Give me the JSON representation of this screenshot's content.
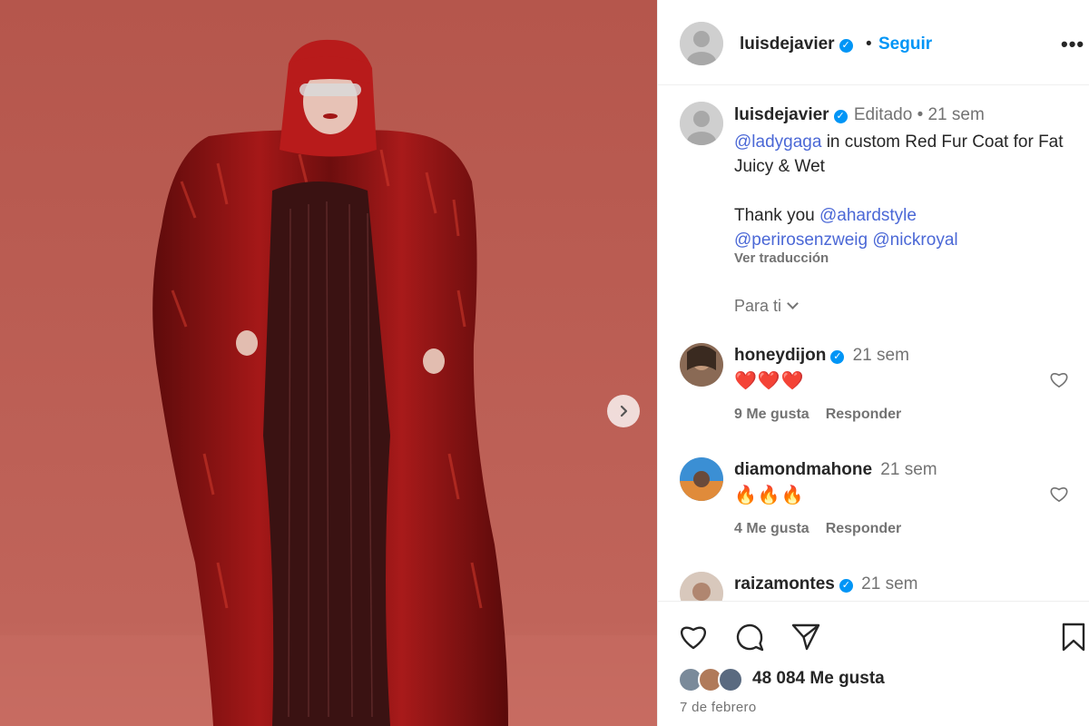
{
  "post": {
    "author": "luisdejavier",
    "verified": "✓",
    "dot": "•",
    "follow_label": "Seguir",
    "more_label": "•••"
  },
  "caption": {
    "author": "luisdejavier",
    "meta": "Editado • 21 sem",
    "mention_gaga": "@ladygaga",
    "line1_rest": " in custom Red Fur Coat for Fat Juicy & Wet",
    "thanks": "Thank you ",
    "mention_1": "@ahardstyle",
    "mention_2": "@perirosenzweig",
    "mention_3": "@nickroyal",
    "translate_label": "Ver traducción"
  },
  "filter": {
    "label": "Para ti"
  },
  "comments": [
    {
      "user": "honeydijon",
      "verified": true,
      "time": "21 sem",
      "text": "❤️❤️❤️",
      "likes": "9 Me gusta",
      "reply": "Responder"
    },
    {
      "user": "diamondmahone",
      "verified": false,
      "time": "21 sem",
      "text": "🔥🔥🔥",
      "likes": "4 Me gusta",
      "reply": "Responder"
    },
    {
      "user": "raizamontes",
      "verified": true,
      "time": "21 sem"
    }
  ],
  "footer": {
    "likes_label": "48 084 Me gusta",
    "date": "7 de febrero"
  },
  "colors": {
    "accent": "#0095f6",
    "mention": "#4b68d6",
    "muted": "#737373",
    "photo_background": "#b85a4f",
    "coat": "#8e1414"
  },
  "icons": [
    "heart-icon",
    "comment-icon",
    "share-icon",
    "bookmark-icon",
    "chevron-right-icon",
    "chevron-down-icon",
    "verified-icon",
    "more-icon"
  ]
}
